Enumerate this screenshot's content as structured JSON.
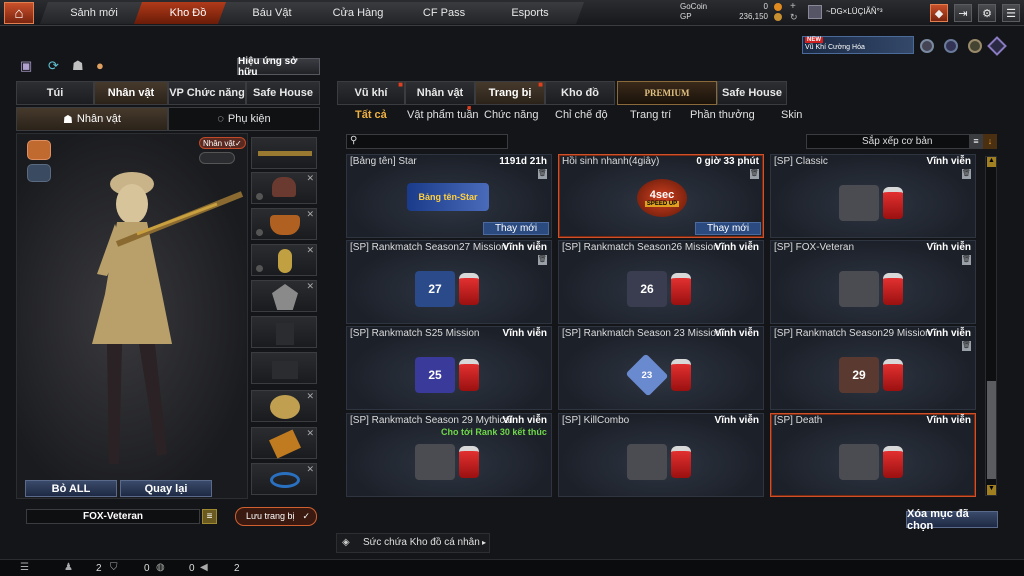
{
  "top_nav": {
    "tabs": [
      "Sảnh mới",
      "Kho Đồ",
      "Báu Vật",
      "Cửa Hàng",
      "CF Pass",
      "Esports"
    ],
    "gocoin_label": "GoCoin",
    "gocoin_value": "0",
    "gp_label": "GP",
    "gp_value": "236,150",
    "player_name": "~DG×LÜÇIÃÑ°³"
  },
  "promo": {
    "badge": "NEW",
    "text": "Vũ Khí Cường Hóa"
  },
  "left": {
    "effect_button": "Hiệu ứng sở hữu",
    "tabs": [
      "Túi",
      "Nhân vật",
      "VP Chức năng",
      "Safe House"
    ],
    "sub_tabs": [
      "Nhân vật",
      "Phụ kiện"
    ],
    "tag": "Nhân vật",
    "remove_all": "Bỏ ALL",
    "back": "Quay lại",
    "preset_name": "FOX-Veteran",
    "save_outfit": "Lưu trang bị"
  },
  "main_tabs": [
    "Vũ khí",
    "Nhân vật",
    "Trang bị",
    "Kho đồ",
    "PREMIUM",
    "Safe House"
  ],
  "sub_tabs": [
    "Tất cả",
    "Vật phẩm tuần",
    "Chức năng",
    "Chỉ chế độ",
    "Trang trí",
    "Phần thưởng",
    "Skin"
  ],
  "sort_label": "Sắp xếp cơ bản",
  "items": [
    {
      "name": "[Bảng tên] Star",
      "duration": "1191d 21h",
      "art": "Bảng tên-Star",
      "button": "Thay mới"
    },
    {
      "name": "Hồi sinh nhanh(4giây)",
      "duration": "0 giờ 33 phút",
      "art": "4sec",
      "art2": "SPEED UP",
      "button": "Thay mới"
    },
    {
      "name": "[SP] Classic",
      "duration": "Vĩnh viễn"
    },
    {
      "name": "[SP] Rankmatch Season27 Mission",
      "duration": "Vĩnh viễn",
      "art": "27"
    },
    {
      "name": "[SP] Rankmatch Season26 Mission",
      "duration": "Vĩnh viễn",
      "art": "26"
    },
    {
      "name": "[SP] FOX-Veteran",
      "duration": "Vĩnh viễn"
    },
    {
      "name": "[SP] Rankmatch S25 Mission",
      "duration": "Vĩnh viễn",
      "art": "25"
    },
    {
      "name": "[SP] Rankmatch Season 23 Mission",
      "duration": "Vĩnh viễn",
      "art": "23"
    },
    {
      "name": "[SP] Rankmatch Season29 Mission",
      "duration": "Vĩnh viễn",
      "art": "29"
    },
    {
      "name": "[SP] Rankmatch Season 29 Mythical",
      "duration": "Vĩnh viễn",
      "extra": "Cho tới Rank 30 kết thúc"
    },
    {
      "name": "[SP] KillCombo",
      "duration": "Vĩnh viễn"
    },
    {
      "name": "[SP] Death",
      "duration": "Vĩnh viễn"
    }
  ],
  "delete_selected": "Xóa mục đã chọn",
  "storage_label": "Sức chứa Kho đồ cá nhân",
  "status": {
    "a": "2",
    "b": "0",
    "c": "0",
    "d": "2"
  }
}
